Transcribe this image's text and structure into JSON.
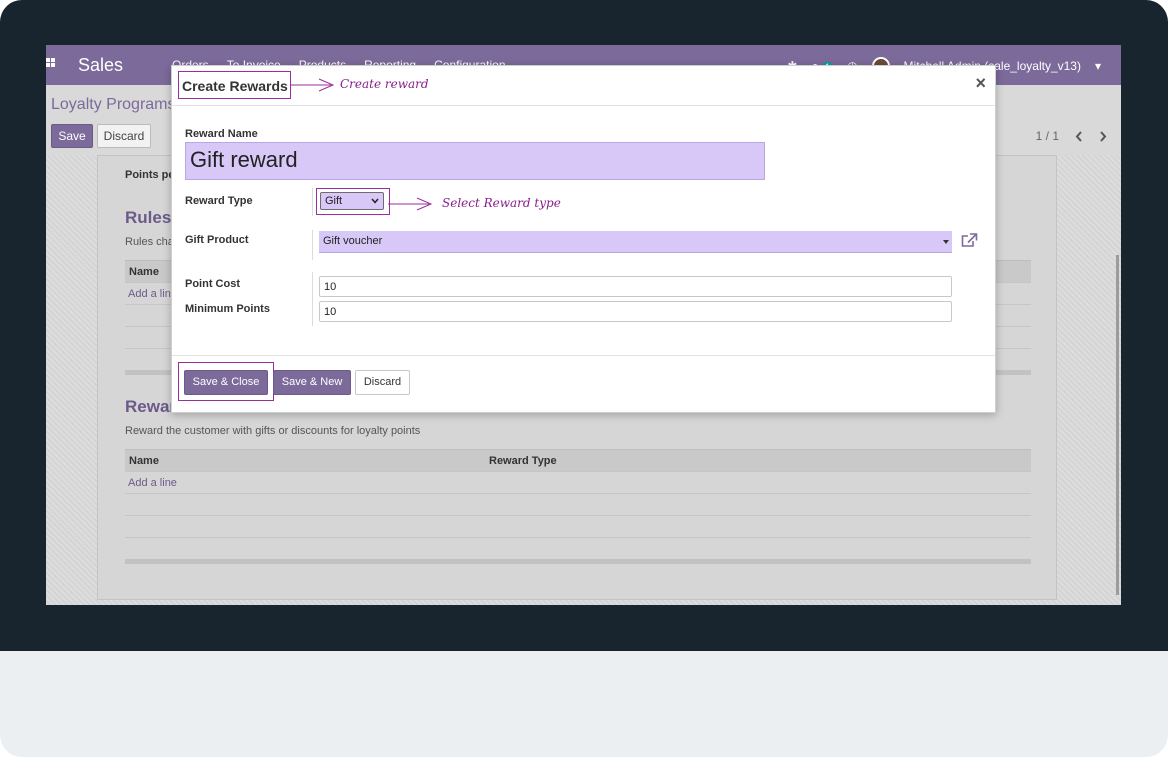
{
  "navbar": {
    "brand": "Sales",
    "menu": [
      "Orders",
      "To Invoice",
      "Products",
      "Reporting",
      "Configuration"
    ],
    "chat_count": "1",
    "user": "Mitchell Admin (sale_loyalty_v13)"
  },
  "control_panel": {
    "breadcrumb": "Loyalty Programs",
    "save_label": "Save",
    "discard_label": "Discard",
    "pager": "1 / 1"
  },
  "background_form": {
    "points_label": "Points pe",
    "rules_title": "Rules",
    "rules_desc": "Rules cha",
    "rules_col_name": "Name",
    "rules_add_line": "Add a line",
    "rewards_title": "Rewar",
    "rewards_desc": "Reward the customer with gifts or discounts for loyalty points",
    "rewards_col_name": "Name",
    "rewards_col_type": "Reward Type",
    "rewards_add_line": "Add a line"
  },
  "modal": {
    "title": "Create Rewards",
    "close": "×",
    "annotation_title": "Create reward",
    "annotation_type": "Select Reward type",
    "reward_name_label": "Reward Name",
    "reward_name_value": "Gift reward",
    "reward_type_label": "Reward Type",
    "reward_type_value": "Gift",
    "gift_product_label": "Gift Product",
    "gift_product_value": "Gift voucher",
    "point_cost_label": "Point Cost",
    "point_cost_value": "10",
    "minimum_points_label": "Minimum Points",
    "minimum_points_value": "10",
    "save_close_label": "Save & Close",
    "save_new_label": "Save & New",
    "discard_label": "Discard"
  },
  "colors": {
    "primary": "#7c6a9b",
    "annotation": "#9c2d9c",
    "required_field": "#d8c8f8"
  }
}
